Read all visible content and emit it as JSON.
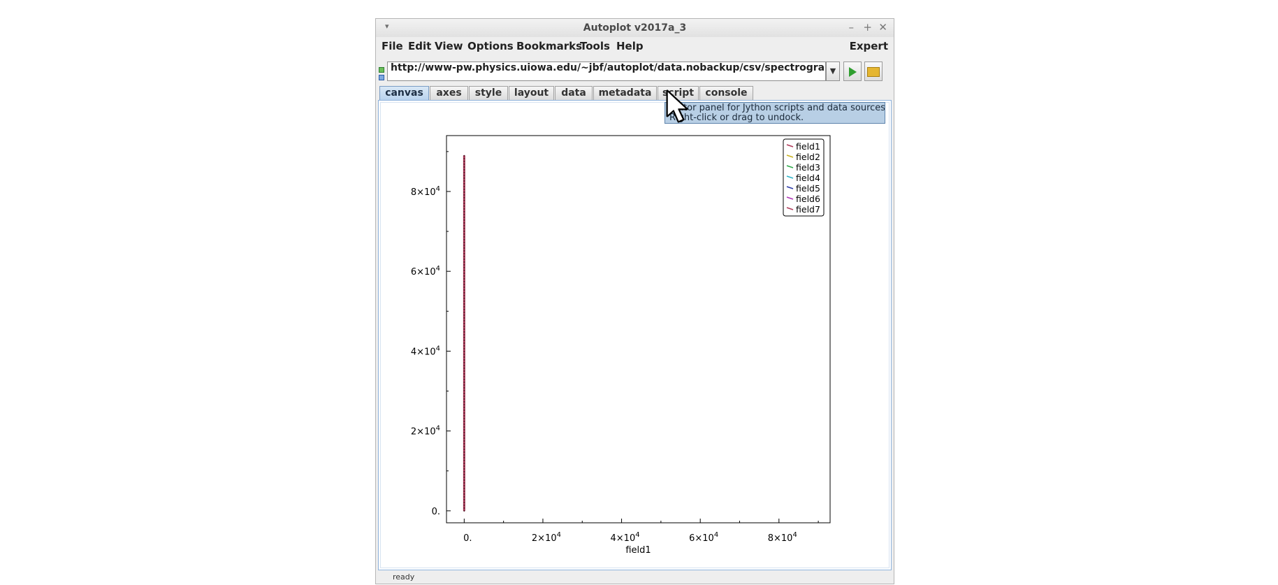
{
  "window": {
    "title": "Autoplot v2017a_3",
    "sysmenu_glyph": "▾",
    "minimize_glyph": "–",
    "maximize_glyph": "+",
    "close_glyph": "✕"
  },
  "menubar": {
    "items": [
      "File",
      "Edit",
      "View",
      "Options",
      "Bookmarks",
      "Tools",
      "Help"
    ],
    "right_item": "Expert"
  },
  "url": {
    "value": "http://www-pw.physics.uiowa.edu/~jbf/autoplot/data.nobackup/csv/spectrogram.csv?bin",
    "dropdown_icon": "chevron-down-icon",
    "plot_button_icon": "play-icon",
    "browse_button_icon": "folder-icon"
  },
  "tabs": [
    "canvas",
    "axes",
    "style",
    "layout",
    "data",
    "metadata",
    "script",
    "console"
  ],
  "active_tab": "canvas",
  "tooltip": {
    "line1": "Editor panel for Jython scripts and data sources.",
    "line2": "Right-click or drag to undock."
  },
  "status": "ready",
  "colors": {
    "active_tab": "#b9d3ee",
    "tooltip_bg": "#b8cfe5",
    "series_line": "#b03a5a"
  },
  "chart_data": {
    "type": "line",
    "xlabel": "field1",
    "ylabel": "",
    "xlim": [
      -4500,
      93000
    ],
    "ylim": [
      -3000,
      94000
    ],
    "x_ticks": [
      0,
      20000,
      40000,
      60000,
      80000
    ],
    "x_tick_labels": [
      {
        "mantissa": "0.",
        "exp": ""
      },
      {
        "mantissa": "2×10",
        "exp": "4"
      },
      {
        "mantissa": "4×10",
        "exp": "4"
      },
      {
        "mantissa": "6×10",
        "exp": "4"
      },
      {
        "mantissa": "8×10",
        "exp": "4"
      }
    ],
    "y_ticks": [
      0,
      20000,
      40000,
      60000,
      80000
    ],
    "y_tick_labels": [
      {
        "mantissa": "0.",
        "exp": ""
      },
      {
        "mantissa": "2×10",
        "exp": "4"
      },
      {
        "mantissa": "4×10",
        "exp": "4"
      },
      {
        "mantissa": "6×10",
        "exp": "4"
      },
      {
        "mantissa": "8×10",
        "exp": "4"
      }
    ],
    "legend": {
      "placement": "top-right",
      "entries": [
        {
          "name": "field1",
          "color": "#b03a5a"
        },
        {
          "name": "field2",
          "color": "#c9b11e"
        },
        {
          "name": "field3",
          "color": "#2ea84a"
        },
        {
          "name": "field4",
          "color": "#2bb3c7"
        },
        {
          "name": "field5",
          "color": "#2c3aa8"
        },
        {
          "name": "field6",
          "color": "#b035b8"
        },
        {
          "name": "field7",
          "color": "#b03a5a"
        }
      ]
    },
    "series": [
      {
        "name": "field1",
        "color": "#b03a5a",
        "x": [
          0,
          0,
          0
        ],
        "y": [
          0,
          30000,
          89000
        ]
      }
    ]
  }
}
